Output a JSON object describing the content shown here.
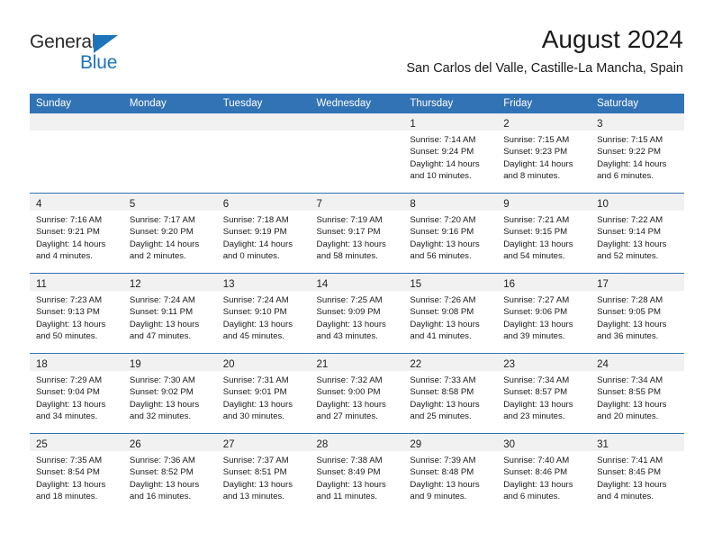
{
  "brand": {
    "name_part1": "General",
    "name_part2": "Blue",
    "color_primary": "#1c75bc",
    "color_text": "#2b2b2b",
    "triangle_icon": "triangle-icon"
  },
  "header": {
    "title": "August 2024",
    "subtitle": "San Carlos del Valle, Castille-La Mancha, Spain"
  },
  "theme": {
    "header_blue": "#3273b5",
    "daynum_band": "#f1f1f1"
  },
  "weekdays": [
    "Sunday",
    "Monday",
    "Tuesday",
    "Wednesday",
    "Thursday",
    "Friday",
    "Saturday"
  ],
  "weeks": [
    [
      {
        "day": "",
        "sunrise": "",
        "sunset": "",
        "daylight1": "",
        "daylight2": ""
      },
      {
        "day": "",
        "sunrise": "",
        "sunset": "",
        "daylight1": "",
        "daylight2": ""
      },
      {
        "day": "",
        "sunrise": "",
        "sunset": "",
        "daylight1": "",
        "daylight2": ""
      },
      {
        "day": "",
        "sunrise": "",
        "sunset": "",
        "daylight1": "",
        "daylight2": ""
      },
      {
        "day": "1",
        "sunrise": "Sunrise: 7:14 AM",
        "sunset": "Sunset: 9:24 PM",
        "daylight1": "Daylight: 14 hours",
        "daylight2": "and 10 minutes."
      },
      {
        "day": "2",
        "sunrise": "Sunrise: 7:15 AM",
        "sunset": "Sunset: 9:23 PM",
        "daylight1": "Daylight: 14 hours",
        "daylight2": "and 8 minutes."
      },
      {
        "day": "3",
        "sunrise": "Sunrise: 7:15 AM",
        "sunset": "Sunset: 9:22 PM",
        "daylight1": "Daylight: 14 hours",
        "daylight2": "and 6 minutes."
      }
    ],
    [
      {
        "day": "4",
        "sunrise": "Sunrise: 7:16 AM",
        "sunset": "Sunset: 9:21 PM",
        "daylight1": "Daylight: 14 hours",
        "daylight2": "and 4 minutes."
      },
      {
        "day": "5",
        "sunrise": "Sunrise: 7:17 AM",
        "sunset": "Sunset: 9:20 PM",
        "daylight1": "Daylight: 14 hours",
        "daylight2": "and 2 minutes."
      },
      {
        "day": "6",
        "sunrise": "Sunrise: 7:18 AM",
        "sunset": "Sunset: 9:19 PM",
        "daylight1": "Daylight: 14 hours",
        "daylight2": "and 0 minutes."
      },
      {
        "day": "7",
        "sunrise": "Sunrise: 7:19 AM",
        "sunset": "Sunset: 9:17 PM",
        "daylight1": "Daylight: 13 hours",
        "daylight2": "and 58 minutes."
      },
      {
        "day": "8",
        "sunrise": "Sunrise: 7:20 AM",
        "sunset": "Sunset: 9:16 PM",
        "daylight1": "Daylight: 13 hours",
        "daylight2": "and 56 minutes."
      },
      {
        "day": "9",
        "sunrise": "Sunrise: 7:21 AM",
        "sunset": "Sunset: 9:15 PM",
        "daylight1": "Daylight: 13 hours",
        "daylight2": "and 54 minutes."
      },
      {
        "day": "10",
        "sunrise": "Sunrise: 7:22 AM",
        "sunset": "Sunset: 9:14 PM",
        "daylight1": "Daylight: 13 hours",
        "daylight2": "and 52 minutes."
      }
    ],
    [
      {
        "day": "11",
        "sunrise": "Sunrise: 7:23 AM",
        "sunset": "Sunset: 9:13 PM",
        "daylight1": "Daylight: 13 hours",
        "daylight2": "and 50 minutes."
      },
      {
        "day": "12",
        "sunrise": "Sunrise: 7:24 AM",
        "sunset": "Sunset: 9:11 PM",
        "daylight1": "Daylight: 13 hours",
        "daylight2": "and 47 minutes."
      },
      {
        "day": "13",
        "sunrise": "Sunrise: 7:24 AM",
        "sunset": "Sunset: 9:10 PM",
        "daylight1": "Daylight: 13 hours",
        "daylight2": "and 45 minutes."
      },
      {
        "day": "14",
        "sunrise": "Sunrise: 7:25 AM",
        "sunset": "Sunset: 9:09 PM",
        "daylight1": "Daylight: 13 hours",
        "daylight2": "and 43 minutes."
      },
      {
        "day": "15",
        "sunrise": "Sunrise: 7:26 AM",
        "sunset": "Sunset: 9:08 PM",
        "daylight1": "Daylight: 13 hours",
        "daylight2": "and 41 minutes."
      },
      {
        "day": "16",
        "sunrise": "Sunrise: 7:27 AM",
        "sunset": "Sunset: 9:06 PM",
        "daylight1": "Daylight: 13 hours",
        "daylight2": "and 39 minutes."
      },
      {
        "day": "17",
        "sunrise": "Sunrise: 7:28 AM",
        "sunset": "Sunset: 9:05 PM",
        "daylight1": "Daylight: 13 hours",
        "daylight2": "and 36 minutes."
      }
    ],
    [
      {
        "day": "18",
        "sunrise": "Sunrise: 7:29 AM",
        "sunset": "Sunset: 9:04 PM",
        "daylight1": "Daylight: 13 hours",
        "daylight2": "and 34 minutes."
      },
      {
        "day": "19",
        "sunrise": "Sunrise: 7:30 AM",
        "sunset": "Sunset: 9:02 PM",
        "daylight1": "Daylight: 13 hours",
        "daylight2": "and 32 minutes."
      },
      {
        "day": "20",
        "sunrise": "Sunrise: 7:31 AM",
        "sunset": "Sunset: 9:01 PM",
        "daylight1": "Daylight: 13 hours",
        "daylight2": "and 30 minutes."
      },
      {
        "day": "21",
        "sunrise": "Sunrise: 7:32 AM",
        "sunset": "Sunset: 9:00 PM",
        "daylight1": "Daylight: 13 hours",
        "daylight2": "and 27 minutes."
      },
      {
        "day": "22",
        "sunrise": "Sunrise: 7:33 AM",
        "sunset": "Sunset: 8:58 PM",
        "daylight1": "Daylight: 13 hours",
        "daylight2": "and 25 minutes."
      },
      {
        "day": "23",
        "sunrise": "Sunrise: 7:34 AM",
        "sunset": "Sunset: 8:57 PM",
        "daylight1": "Daylight: 13 hours",
        "daylight2": "and 23 minutes."
      },
      {
        "day": "24",
        "sunrise": "Sunrise: 7:34 AM",
        "sunset": "Sunset: 8:55 PM",
        "daylight1": "Daylight: 13 hours",
        "daylight2": "and 20 minutes."
      }
    ],
    [
      {
        "day": "25",
        "sunrise": "Sunrise: 7:35 AM",
        "sunset": "Sunset: 8:54 PM",
        "daylight1": "Daylight: 13 hours",
        "daylight2": "and 18 minutes."
      },
      {
        "day": "26",
        "sunrise": "Sunrise: 7:36 AM",
        "sunset": "Sunset: 8:52 PM",
        "daylight1": "Daylight: 13 hours",
        "daylight2": "and 16 minutes."
      },
      {
        "day": "27",
        "sunrise": "Sunrise: 7:37 AM",
        "sunset": "Sunset: 8:51 PM",
        "daylight1": "Daylight: 13 hours",
        "daylight2": "and 13 minutes."
      },
      {
        "day": "28",
        "sunrise": "Sunrise: 7:38 AM",
        "sunset": "Sunset: 8:49 PM",
        "daylight1": "Daylight: 13 hours",
        "daylight2": "and 11 minutes."
      },
      {
        "day": "29",
        "sunrise": "Sunrise: 7:39 AM",
        "sunset": "Sunset: 8:48 PM",
        "daylight1": "Daylight: 13 hours",
        "daylight2": "and 9 minutes."
      },
      {
        "day": "30",
        "sunrise": "Sunrise: 7:40 AM",
        "sunset": "Sunset: 8:46 PM",
        "daylight1": "Daylight: 13 hours",
        "daylight2": "and 6 minutes."
      },
      {
        "day": "31",
        "sunrise": "Sunrise: 7:41 AM",
        "sunset": "Sunset: 8:45 PM",
        "daylight1": "Daylight: 13 hours",
        "daylight2": "and 4 minutes."
      }
    ]
  ]
}
